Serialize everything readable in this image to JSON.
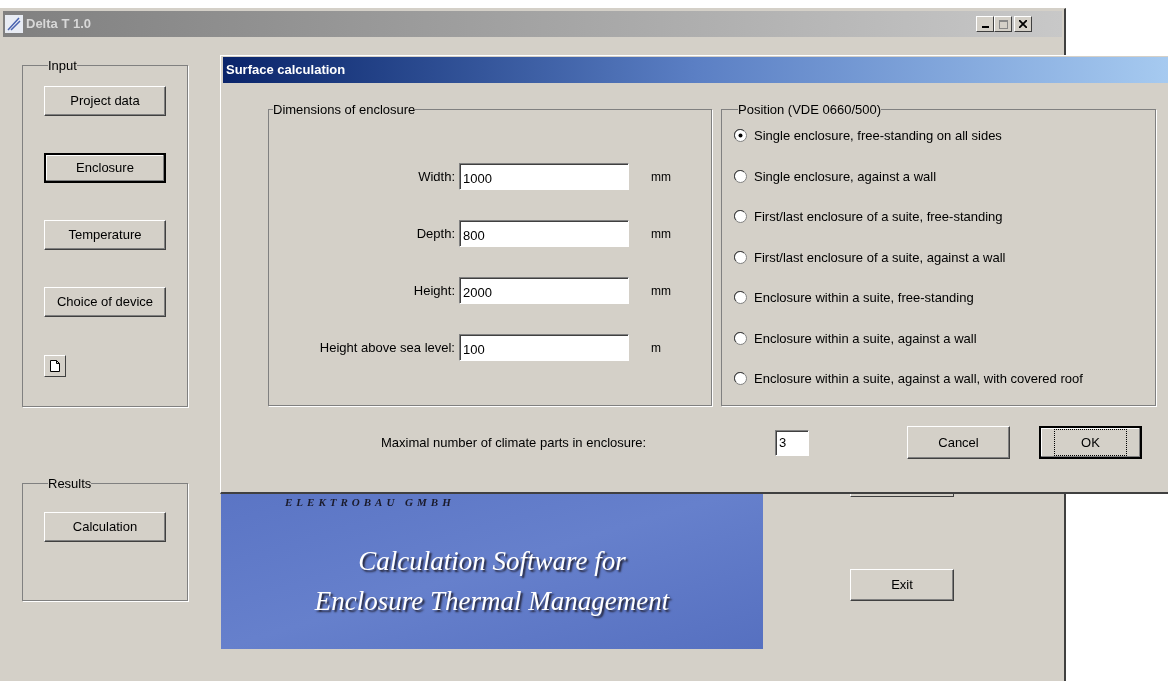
{
  "main_window": {
    "title": "Delta T 1.0",
    "input_group": {
      "title": "Input",
      "buttons": [
        {
          "label": "Project data",
          "focused": false
        },
        {
          "label": "Enclosure",
          "focused": true
        },
        {
          "label": "Temperature",
          "focused": false
        },
        {
          "label": "Choice of device",
          "focused": false
        }
      ]
    },
    "results_group": {
      "title": "Results",
      "buttons": [
        "Calculation"
      ]
    },
    "banner": {
      "company": "ELEKTROBAU GMBH",
      "tagline": [
        "Calculation Software for",
        "Enclosure Thermal Management"
      ]
    },
    "exit_button": "Exit"
  },
  "dialog": {
    "title": "Surface calculation",
    "dimensions": {
      "title": "Dimensions of enclosure",
      "fields": [
        {
          "label": "Width:",
          "value": "1000",
          "unit": "mm"
        },
        {
          "label": "Depth:",
          "value": "800",
          "unit": "mm"
        },
        {
          "label": "Height:",
          "value": "2000",
          "unit": "mm"
        },
        {
          "label": "Height above sea level:",
          "value": "100",
          "unit": "m"
        }
      ]
    },
    "position": {
      "title": "Position (VDE 0660/500)",
      "options": [
        {
          "label": "Single enclosure, free-standing on all sides",
          "selected": true
        },
        {
          "label": "Single enclosure, against a wall",
          "selected": false
        },
        {
          "label": "First/last enclosure of a suite, free-standing",
          "selected": false
        },
        {
          "label": "First/last enclosure of a suite, against a wall",
          "selected": false
        },
        {
          "label": "Enclosure within a suite, free-standing",
          "selected": false
        },
        {
          "label": "Enclosure within a suite, against a wall",
          "selected": false
        },
        {
          "label": "Enclosure within a suite, against a wall, with covered roof",
          "selected": false
        }
      ]
    },
    "climate_parts": {
      "label": "Maximal number of climate parts in enclosure:",
      "value": "3"
    },
    "buttons": [
      {
        "label": "Cancel",
        "default": false
      },
      {
        "label": "OK",
        "default": true
      }
    ]
  }
}
